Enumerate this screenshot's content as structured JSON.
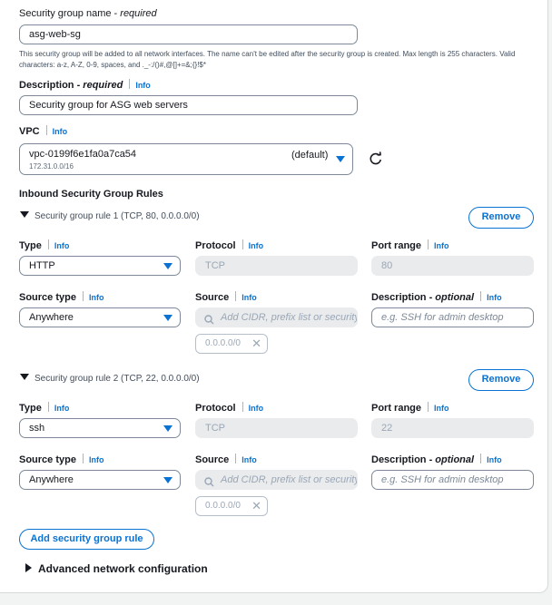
{
  "sg_name": {
    "label": "Security group name",
    "required": "required",
    "value": "asg-web-sg",
    "help": "This security group will be added to all network interfaces. The name can't be edited after the security group is created. Max length is 255 characters. Valid characters: a-z, A-Z, 0-9, spaces, and ._-:/()#,@[]+=&;{}!$*"
  },
  "description": {
    "label": "Description",
    "required": "required",
    "info": "Info",
    "value": "Security group for ASG web servers"
  },
  "vpc": {
    "label": "VPC",
    "info": "Info",
    "id": "vpc-0199f6e1fa0a7ca54",
    "default": "(default)",
    "cidr": "172.31.0.0/16"
  },
  "inbound": {
    "title": "Inbound Security Group Rules",
    "remove_label": "Remove",
    "labels": {
      "type": "Type",
      "protocol": "Protocol",
      "port_range": "Port range",
      "source_type": "Source type",
      "source": "Source",
      "description": "Description",
      "optional": "optional",
      "info": "Info"
    },
    "source_placeholder": "Add CIDR, prefix list or security",
    "description_placeholder": "e.g. SSH for admin desktop",
    "rules": [
      {
        "title": "Security group rule 1 (TCP, 80, 0.0.0.0/0)",
        "type": "HTTP",
        "protocol": "TCP",
        "port": "80",
        "source_type": "Anywhere",
        "token": "0.0.0.0/0"
      },
      {
        "title": "Security group rule 2 (TCP, 22, 0.0.0.0/0)",
        "type": "ssh",
        "protocol": "TCP",
        "port": "22",
        "source_type": "Anywhere",
        "token": "0.0.0.0/0"
      }
    ],
    "add_rule_label": "Add security group rule"
  },
  "advanced": {
    "label": "Advanced network configuration"
  },
  "colors": {
    "accent": "#0972d3",
    "border": "#7d8998",
    "disabled_bg": "#e9ebed"
  },
  "icons": [
    "refresh-icon",
    "search-icon",
    "close-icon",
    "caret-down-icon",
    "expand-triangle-icon"
  ]
}
